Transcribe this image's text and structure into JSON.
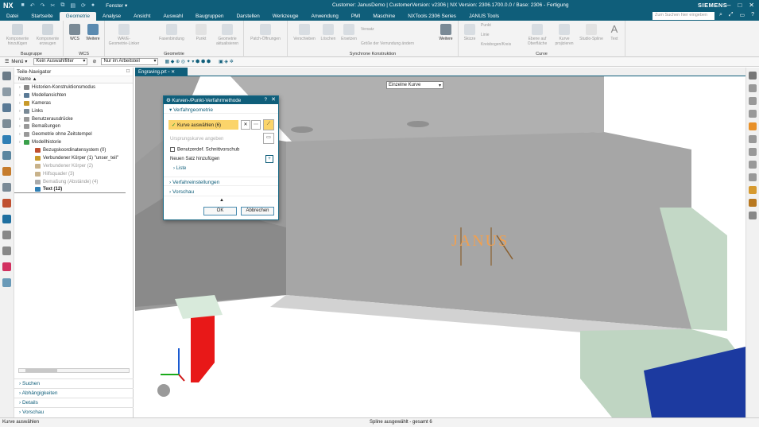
{
  "titlebar": {
    "app": "NX",
    "window_menu": "Fenster",
    "title": "Customer: JanusDemo | CustomerVersion: v2306 | NX Version: 2306.1700.0.0 / Base: 2306 - Fertigung",
    "brand": "SIEMENS"
  },
  "menubar": {
    "tabs": [
      "Datei",
      "Startseite",
      "Geometrie",
      "Analyse",
      "Ansicht",
      "Auswahl",
      "Baugruppen",
      "Darstellen",
      "Werkzeuge",
      "Anwendung",
      "PMI",
      "Maschine",
      "NXTools 2306 Series",
      "JANUS Tools"
    ],
    "active": "Geometrie",
    "search_placeholder": "Zum Suchen hier eingeben"
  },
  "ribbon": {
    "groups": [
      {
        "label": "Baugruppe",
        "buttons": [
          "Komponente hinzufügen",
          "Komponente erzeugen"
        ]
      },
      {
        "label": "WCS",
        "buttons": [
          "WCS",
          "Weitere"
        ]
      },
      {
        "label": "Geometrie",
        "buttons": [
          "WAVE-Geometrie-Linker",
          "Fasenbindung",
          "Punkt",
          "Geometrie aktualisieren"
        ]
      },
      {
        "label": "",
        "buttons": [
          "Patch-Öffnungen"
        ]
      },
      {
        "label": "Synchrone Konstruktion",
        "buttons": [
          "Verschieben",
          "Löschen",
          "Ersetzen",
          "Versatz",
          "Größe der Verrundung ändern",
          "Weitere"
        ]
      },
      {
        "label": "Curve",
        "buttons": [
          "Skizze",
          "Punkt",
          "Linie",
          "Kreisbogen/Kreis",
          "Ebene auf Oberfläche",
          "Kurve projizieren",
          "Studio-Spline",
          "Text"
        ]
      }
    ]
  },
  "selbar": {
    "menu": "Menü",
    "filter": "Kein Auswahlfilter",
    "scope": "Nur im Arbeitsteil"
  },
  "navigator": {
    "title": "Teile-Navigator",
    "column": "Name",
    "items": [
      {
        "label": "Historien-Konstruktionsmodus",
        "level": 0,
        "style": "normal"
      },
      {
        "label": "Modellansichten",
        "level": 0,
        "style": "normal"
      },
      {
        "label": "Kameras",
        "level": 0,
        "style": "normal"
      },
      {
        "label": "Links",
        "level": 0,
        "style": "normal"
      },
      {
        "label": "Benutzerausdrücke",
        "level": 0,
        "style": "normal"
      },
      {
        "label": "Bemaßungen",
        "level": 0,
        "style": "normal"
      },
      {
        "label": "Geometrie ohne Zeitstempel",
        "level": 0,
        "style": "normal"
      },
      {
        "label": "Modellhistorie",
        "level": 0,
        "style": "normal"
      },
      {
        "label": "Bezugskoordinatensystem (0)",
        "level": 1,
        "style": "normal"
      },
      {
        "label": "Verbundener Körper (1) \"unser_teil\"",
        "level": 1,
        "style": "normal"
      },
      {
        "label": "Verbundener Körper (2)",
        "level": 1,
        "style": "gray"
      },
      {
        "label": "Hilfsquader (3)",
        "level": 1,
        "style": "gray"
      },
      {
        "label": "Bemaßung (Abstände) (4)",
        "level": 1,
        "style": "gray"
      },
      {
        "label": "Text (12)",
        "level": 1,
        "style": "bold"
      }
    ],
    "panels": [
      "Suchen",
      "Abhängigkeiten",
      "Details",
      "Vorschau"
    ]
  },
  "graphics": {
    "tab": "Engraving.prt",
    "selection_filter": "Einzelne Kurve",
    "engraved_text": "JANUS"
  },
  "dialog": {
    "title": "Kurven-/Punkt-Verfahrmethode",
    "section1": "Verfahrgeometrie",
    "select_curve": "Kurve auswählen (6)",
    "origin_curve": "Ursprungskurve angeben",
    "user_offset": "Benutzerdef. Schnittvorschub",
    "new_set": "Neuen Satz hinzufügen",
    "list": "Liste",
    "section2": "Verfahreinstellungen",
    "section3": "Vorschau",
    "ok": "OK",
    "cancel": "Abbrechen"
  },
  "status": {
    "left": "Kurve auswählen",
    "center": "Spline ausgewählt - gesamt 6"
  },
  "colors": {
    "accent": "#0f5e7a",
    "highlight": "#fbd46a",
    "engraving": "#f0a050"
  }
}
